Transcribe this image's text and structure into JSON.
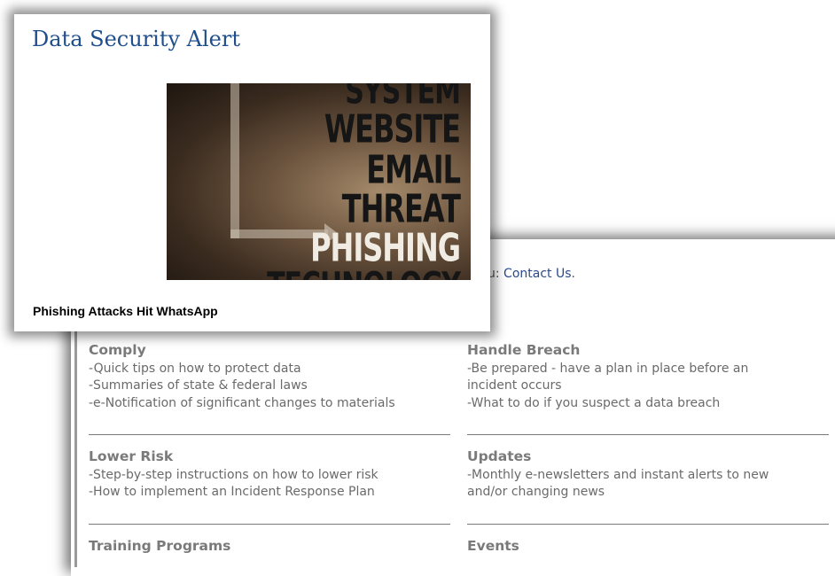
{
  "card": {
    "title": "Data Security Alert",
    "image_words": [
      "SYSTEM",
      "WEBSITE",
      "EMAIL",
      "THREAT",
      "PHISHING",
      "TECHNOLOGY"
    ],
    "caption": "Phishing Attacks Hit WhatsApp"
  },
  "contact": {
    "prefix": "u: ",
    "link": "Contact Us",
    "suffix": "."
  },
  "sections": {
    "comply": {
      "heading": "Comply",
      "lines": [
        "-Quick tips on how to protect data",
        "-Summaries of state & federal laws",
        "-e-Notification of significant changes to materials"
      ]
    },
    "handle_breach": {
      "heading": "Handle Breach",
      "lines": [
        "-Be prepared - have a plan in place before an",
        "incident occurs",
        "-What to do if you suspect a data breach"
      ]
    },
    "lower_risk": {
      "heading": "Lower Risk",
      "lines": [
        "-Step-by-step instructions on how to lower risk",
        "-How to implement an Incident Response Plan"
      ]
    },
    "updates": {
      "heading": "Updates",
      "lines": [
        "-Monthly e-newsletters and instant alerts to new",
        "and/or changing news"
      ]
    },
    "training": {
      "heading": "Training Programs"
    },
    "events": {
      "heading": "Events"
    }
  },
  "colors": {
    "title_blue": "#1f4e8c",
    "link_blue": "#2a4a8a",
    "section_gray": "#7a7a7a"
  }
}
